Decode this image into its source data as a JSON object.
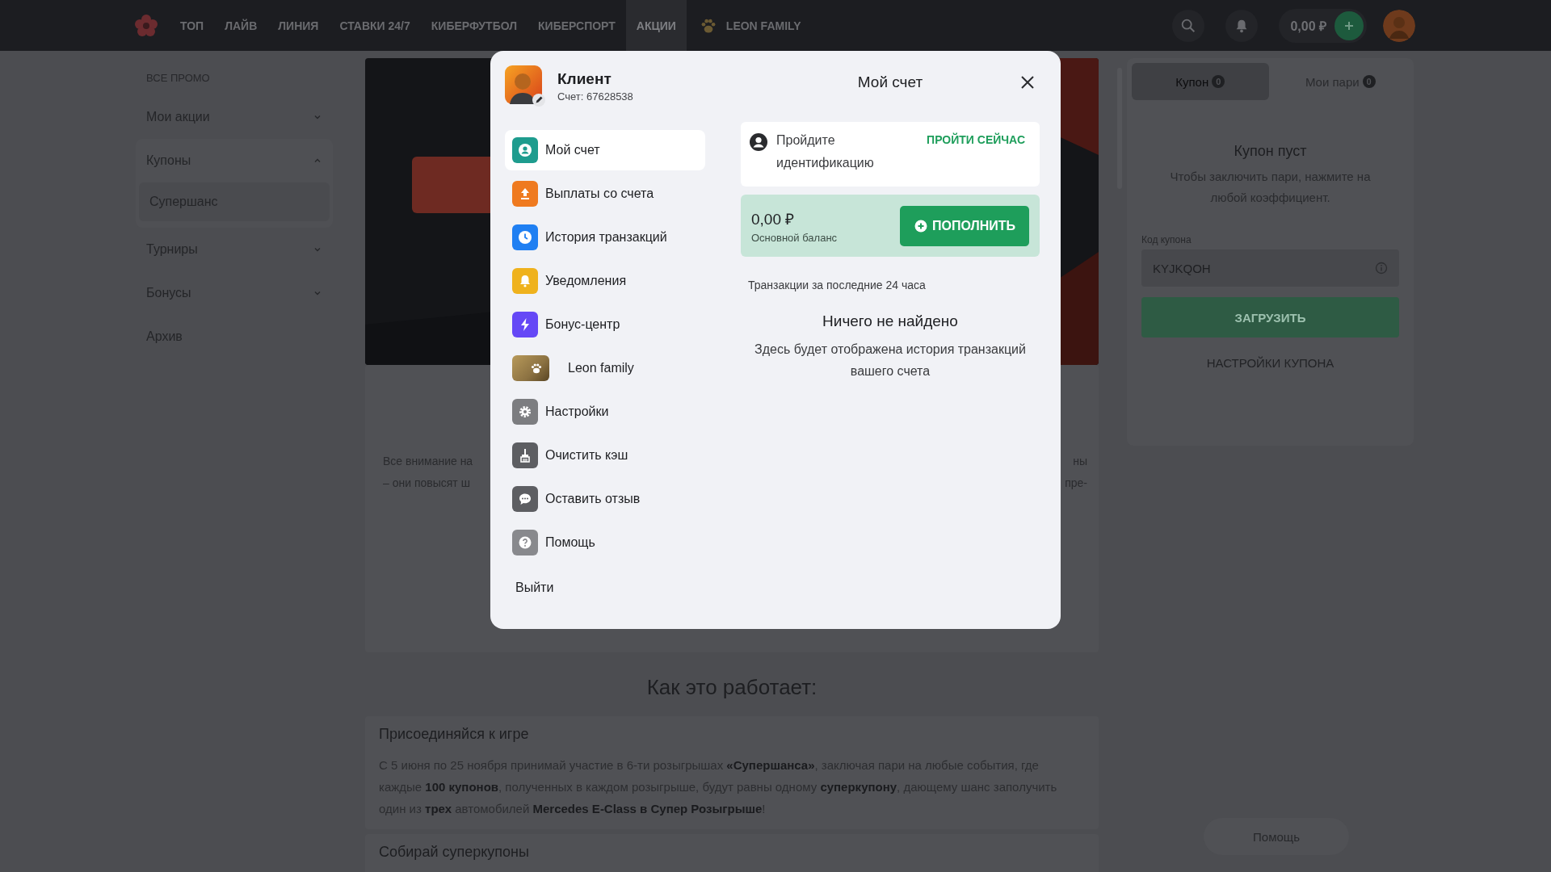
{
  "nav": {
    "items": [
      {
        "label": "ТОП",
        "selected": false,
        "kind": "text"
      },
      {
        "label": "ЛАЙВ",
        "selected": false,
        "kind": "text"
      },
      {
        "label": "ЛИНИЯ",
        "selected": false,
        "kind": "text"
      },
      {
        "label": "СТАВКИ 24/7",
        "selected": false,
        "kind": "text"
      },
      {
        "label": "КИБЕРФУТБОЛ",
        "selected": false,
        "kind": "text"
      },
      {
        "label": "КИБЕРСПОРТ",
        "selected": false,
        "kind": "text"
      },
      {
        "label": "АКЦИИ",
        "selected": true,
        "kind": "text"
      },
      {
        "label": "LEON FAMILY",
        "selected": false,
        "kind": "family"
      }
    ],
    "balance": "0,00 ₽"
  },
  "sidebar": {
    "heading": "ВСЕ ПРОМО",
    "items": [
      {
        "label": "Мои акции",
        "kind": "group",
        "expanded": false
      },
      {
        "label": "Купоны",
        "kind": "group",
        "expanded": true,
        "children": [
          {
            "label": "Супершанс",
            "selected": true
          }
        ]
      },
      {
        "label": "Турниры",
        "kind": "group",
        "expanded": false
      },
      {
        "label": "Бонусы",
        "kind": "group",
        "expanded": false
      },
      {
        "label": "Архив",
        "kind": "link"
      }
    ]
  },
  "promo_text": {
    "lines": [
      {
        "left": "Все внимание на",
        "right": "ны"
      },
      {
        "left": "– они повысят ш",
        "right": "пре-"
      }
    ]
  },
  "how_it_works": {
    "title": "Как это работает:",
    "sections": [
      {
        "title": "Присоединяйся к игре",
        "text": "С 5 июня по 25 ноября принимай участие в 6-ти розыгрышах **«Супершанса»**, заключая пари на любые события, где каждые **100 купонов**, полученных в каждом розыгрыше, будут равны одному **суперкупону**, дающему шанс заполучить один из **трех** автомобилей **Mercedes E-Class в Супер Розыгрыше**!"
      },
      {
        "title": "Собирай суперкупоны"
      }
    ]
  },
  "coupon_panel": {
    "tabs": [
      {
        "label": "Купон",
        "count": "0",
        "selected": true
      },
      {
        "label": "Мои пари",
        "count": "0",
        "selected": false
      }
    ],
    "empty_title": "Купон пуст",
    "empty_text": "Чтобы заключить пари, нажмите на любой коэффициент.",
    "code_label": "Код купона",
    "code_placeholder": "KYJKQOH",
    "load_button": {
      "label": "ЗАГРУЗИТЬ",
      "disabled": true
    },
    "settings_link": "НАСТРОЙКИ КУПОНА"
  },
  "help_button": "Помощь",
  "modal": {
    "user_name": "Клиент",
    "account": "Счет: 67628538",
    "title": "Мой счет",
    "menu": [
      {
        "label": "Мой счет",
        "color": "#1e9c8e",
        "selected": true,
        "kind": "icon"
      },
      {
        "label": "Выплаты со счета",
        "color": "#ef7a1f",
        "selected": false,
        "kind": "icon"
      },
      {
        "label": "История транзакций",
        "color": "#1f7ff2",
        "selected": false,
        "kind": "icon"
      },
      {
        "label": "Уведомления",
        "color": "#efb21d",
        "selected": false,
        "kind": "icon"
      },
      {
        "label": "Бонус-центр",
        "color": "#6548f6",
        "selected": false,
        "kind": "icon"
      },
      {
        "label": "Leon family",
        "color": "#8c7242",
        "selected": false
      },
      {
        "label": "Настройки",
        "color": "#7c7d80",
        "selected": false,
        "kind": "icon"
      },
      {
        "label": "Очистить кэш",
        "color": "#5d5e62",
        "selected": false,
        "kind": "icon"
      },
      {
        "label": "Оставить отзыв",
        "color": "#5d5e62",
        "selected": false,
        "kind": "icon"
      },
      {
        "label": "Помощь",
        "color": "#88898d",
        "selected": false,
        "kind": "icon"
      }
    ],
    "logout": "Выйти",
    "identification": {
      "text": "Пройдите идентификацию",
      "link": "ПРОЙТИ СЕЙЧАС"
    },
    "balance": {
      "amount": "0,00 ₽",
      "label": "Основной баланс",
      "button": "ПОПОЛНИТЬ"
    },
    "transactions_heading": "Транзакции за последние 24 часа",
    "empty_title": "Ничего не найдено",
    "empty_text": "Здесь будет отображена история транзакций вашего счета"
  }
}
